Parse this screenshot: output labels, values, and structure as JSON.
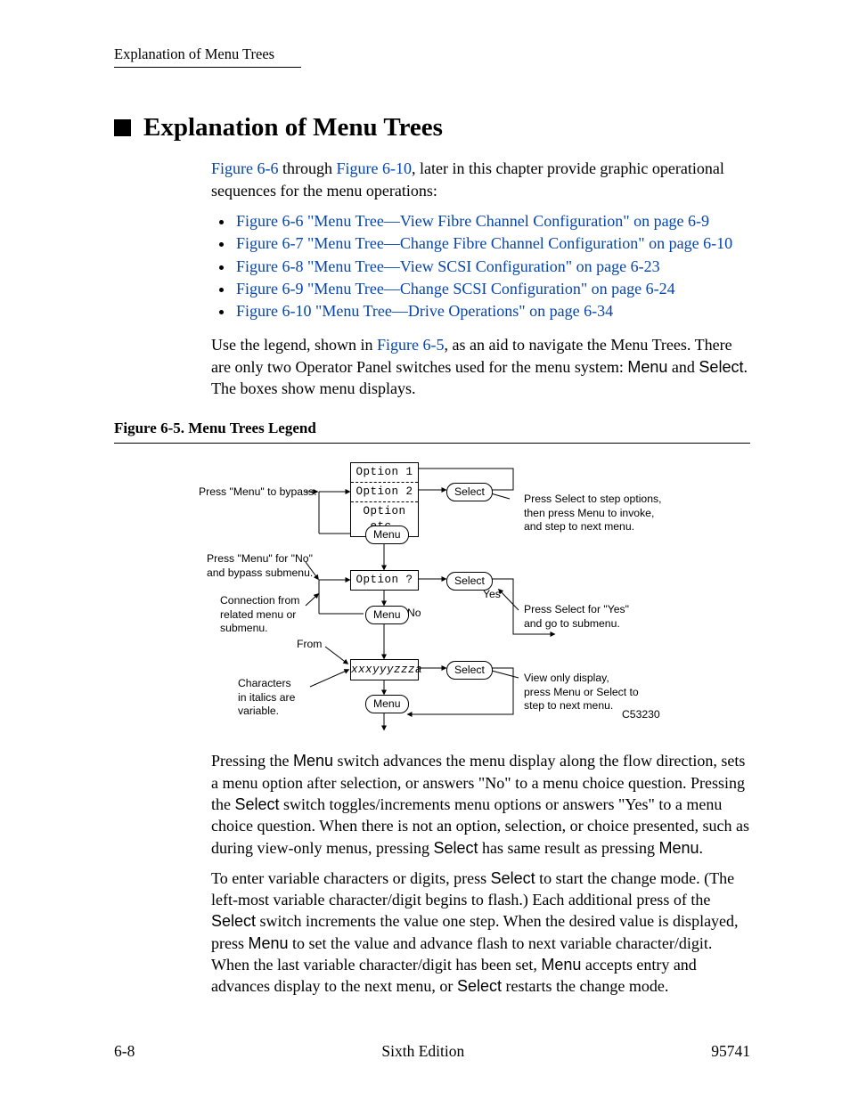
{
  "header": {
    "running": "Explanation of Menu Trees"
  },
  "title": "Explanation of Menu Trees",
  "intro": {
    "link1": "Figure 6-6",
    "mid1": " through ",
    "link2": "Figure 6-10",
    "rest": ", later in this chapter provide graphic operational sequences for the menu operations:"
  },
  "bullets": [
    "Figure 6-6 \"Menu Tree—View Fibre Channel Configuration\" on page 6-9",
    "Figure 6-7 \"Menu Tree—Change Fibre Channel Configuration\" on page 6-10",
    "Figure 6-8 \"Menu Tree—View SCSI Configuration\" on page 6-23",
    "Figure 6-9 \"Menu Tree—Change SCSI Configuration\" on page 6-24",
    "Figure 6-10 \"Menu Tree—Drive Operations\" on page 6-34"
  ],
  "legend_para": {
    "pre": "Use the legend, shown in ",
    "link": "Figure 6-5",
    "post": ", as an aid to navigate the Menu Trees. There are only two Operator Panel switches used for the menu system: ",
    "menu": "Menu",
    "and": " and ",
    "select": "Select",
    "tail": ". The boxes show menu displays."
  },
  "figure_caption": "Figure 6-5. Menu Trees Legend",
  "diagram": {
    "opt1": "Option  1",
    "opt2": "Option  2",
    "opt3": "Option  etc.",
    "optq": "Option ?",
    "xxy": "xxxyyyzzza",
    "menu": "Menu",
    "select": "Select",
    "yes": "Yes",
    "no": "No",
    "from": "From",
    "left1": "Press \"Menu\" to bypass.",
    "left2a": "Press \"Menu\" for \"No\"",
    "left2b": "and bypass submenu.",
    "left3a": "Connection from",
    "left3b": "related menu or",
    "left3c": "submenu.",
    "left4a": "Characters",
    "left4b": "in italics are",
    "left4c": "variable.",
    "right1a": "Press Select to step options,",
    "right1b": "then press Menu to invoke,",
    "right1c": "and step to next menu.",
    "right2a": "Press Select for \"Yes\"",
    "right2b": "and go to submenu.",
    "right3a": "View only display,",
    "right3b": "press Menu or Select to",
    "right3c": "step to next menu.",
    "code": "C53230"
  },
  "body_p1": {
    "a": "Pressing the ",
    "menu1": "Menu",
    "b": " switch advances the menu display along the flow direction, sets a menu option after selection, or answers \"No\" to a menu choice question. Pressing the ",
    "select1": "Select",
    "c": " switch toggles/increments menu options or answers \"Yes\" to a menu choice question. When there is not an option, selection, or choice presented, such as during view-only menus, pressing ",
    "select2": "Select",
    "d": " has same result as pressing ",
    "menu2": "Menu",
    "e": "."
  },
  "body_p2": {
    "a": "To enter variable characters or digits, press ",
    "select1": "Select",
    "b": " to start the change mode. (The left-most variable character/digit begins to flash.) Each additional press of the ",
    "select2": "Select",
    "c": " switch increments the value one step. When the desired value is displayed, press ",
    "menu1": "Menu",
    "d": " to set the value and advance flash to next variable character/digit. When the last variable character/digit has been set, ",
    "menu2": "Menu",
    "e": " accepts entry and advances display to the next menu, or ",
    "select3": "Select",
    "f": " restarts the change mode."
  },
  "footer": {
    "left": "6-8",
    "center": "Sixth Edition",
    "right": "95741"
  }
}
